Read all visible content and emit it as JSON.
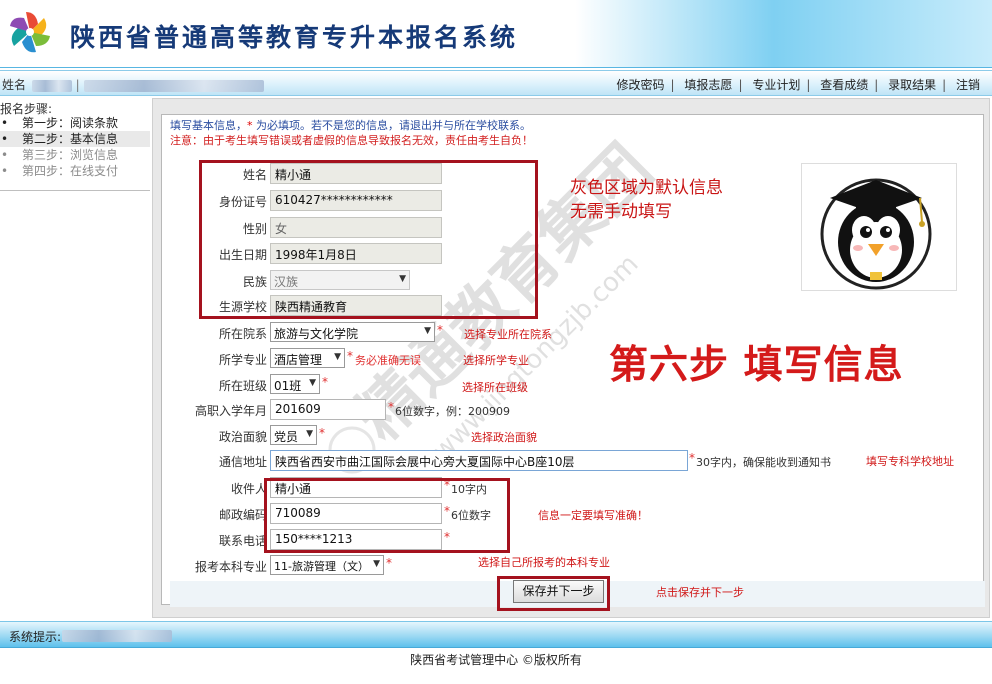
{
  "header": {
    "title": "陕西省普通高等教育专升本报名系统"
  },
  "topbar": {
    "name_label": "姓名",
    "links": [
      "修改密码",
      "填报志愿",
      "专业计划",
      "查看成绩",
      "录取结果",
      "注销"
    ]
  },
  "sidebar": {
    "title": "报名步骤:",
    "steps": [
      {
        "label": "第一步：阅读条款",
        "state": "done"
      },
      {
        "label": "第二步：基本信息",
        "state": "active"
      },
      {
        "label": "第三步：浏览信息",
        "state": "todo"
      },
      {
        "label": "第四步：在线支付",
        "state": "todo"
      }
    ]
  },
  "notice": {
    "line1_a": "填写基本信息，",
    "line1_star": "*",
    "line1_b": " 为必填项。若不是您的信息，请退出并与所在学校联系。",
    "line2": "注意：由于考生填写错误或者虚假的信息导致报名无效，责任由考生自负！"
  },
  "form": {
    "name_label": "姓名",
    "name_value": "精小通",
    "id_label": "身份证号",
    "id_value": "610427************",
    "gender_label": "性别",
    "gender_value": "女",
    "birth_label": "出生日期",
    "birth_value": "1998年1月8日",
    "ethnic_label": "民族",
    "ethnic_value": "汉族",
    "school_label": "生源学校",
    "school_value": "陕西精通教育",
    "college_label": "所在院系",
    "college_value": "旅游与文化学院",
    "major_label": "所学专业",
    "major_value": "酒店管理",
    "major_hint": "务必准确无误",
    "class_label": "所在班级",
    "class_value": "01班",
    "enroll_label": "高职入学年月",
    "enroll_value": "201609",
    "enroll_hint": "6位数字，例：200909",
    "political_label": "政治面貌",
    "political_value": "党员",
    "address_label": "通信地址",
    "address_value": "陕西省西安市曲江国际会展中心旁大夏国际中心B座10层",
    "address_hint": "30字内，确保能收到通知书",
    "receiver_label": "收件人",
    "receiver_value": "精小通",
    "receiver_hint": "10字内",
    "postcode_label": "邮政编码",
    "postcode_value": "710089",
    "postcode_hint": "6位数字",
    "phone_label": "联系电话",
    "phone_value": "150****1213",
    "target_label": "报考本科专业",
    "target_value": "11-旅游管理（文）",
    "required_mark": "*",
    "save_label": "保存并下一步"
  },
  "annotations": {
    "gray_note_1": "灰色区域为默认信息",
    "gray_note_2": "无需手动填写",
    "step_title": "第六步 填写信息",
    "college_note": "选择专业所在院系",
    "major_note": "选择所学专业",
    "class_note": "选择所在班级",
    "political_note": "选择政治面貌",
    "address_note": "填写专科学校地址",
    "info_note": "信息一定要填写准确！",
    "target_note": "选择自己所报考的本科专业",
    "save_note": "点击保存并下一步"
  },
  "watermark": {
    "cn": "精通教育集团",
    "url": "www.jingtongzjb.com"
  },
  "status": {
    "label": "系统提示:"
  },
  "footer": {
    "text": "陕西省考试管理中心 ©版权所有"
  },
  "colors": {
    "accent_blue": "#5ec1ec",
    "annotation_red": "#d01717",
    "box_red": "#a4121e",
    "title_blue": "#163a78"
  }
}
